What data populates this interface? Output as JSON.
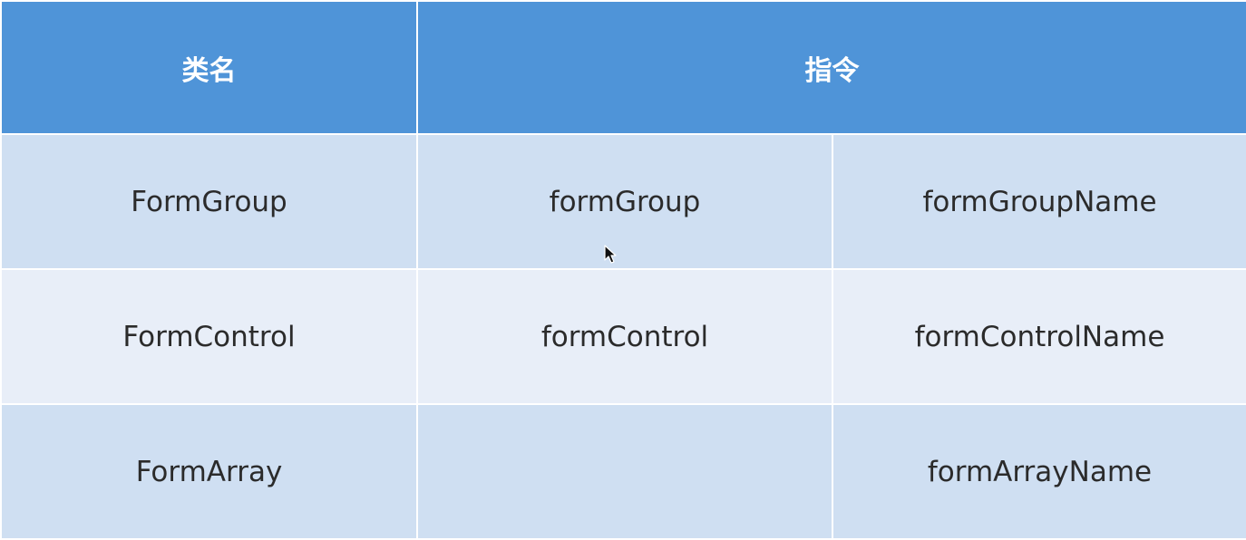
{
  "table": {
    "headers": {
      "class_name": "类名",
      "directive": "指令"
    },
    "rows": [
      {
        "class_name": "FormGroup",
        "directive": "formGroup",
        "directive_name": "formGroupName"
      },
      {
        "class_name": "FormControl",
        "directive": "formControl",
        "directive_name": "formControlName"
      },
      {
        "class_name": "FormArray",
        "directive": "",
        "directive_name": "formArrayName"
      }
    ]
  },
  "colors": {
    "header_bg": "#4f94d8",
    "row_odd_bg": "#cfdff2",
    "row_even_bg": "#e8eef8"
  },
  "cursor": {
    "icon": "mouse-pointer-icon"
  }
}
